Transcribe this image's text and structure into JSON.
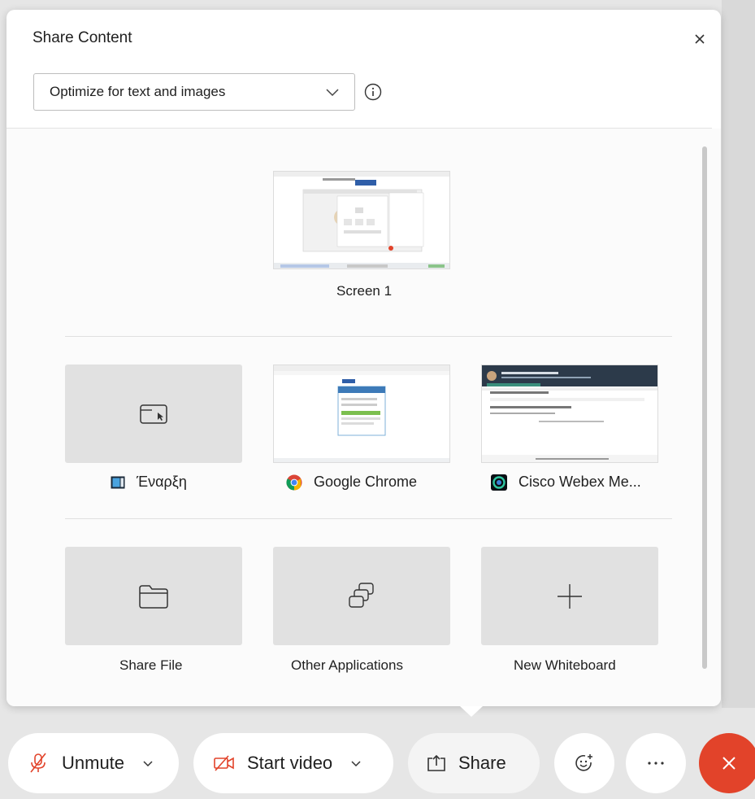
{
  "dialog": {
    "title": "Share Content",
    "optimize_value": "Optimize for text and images"
  },
  "screens": [
    {
      "label": "Screen 1"
    }
  ],
  "apps": [
    {
      "label": "Έναρξη",
      "icon": "start-app-icon"
    },
    {
      "label": "Google Chrome",
      "icon": "chrome-icon"
    },
    {
      "label": "Cisco Webex Me...",
      "icon": "webex-icon"
    }
  ],
  "actions": [
    {
      "label": "Share File",
      "icon": "folder-icon"
    },
    {
      "label": "Other Applications",
      "icon": "stacked-windows-icon"
    },
    {
      "label": "New Whiteboard",
      "icon": "plus-icon"
    }
  ],
  "toolbar": {
    "unmute_label": "Unmute",
    "start_video_label": "Start video",
    "share_label": "Share",
    "leave_color": "#e2432a",
    "mute_icon_color": "#e2432a"
  }
}
